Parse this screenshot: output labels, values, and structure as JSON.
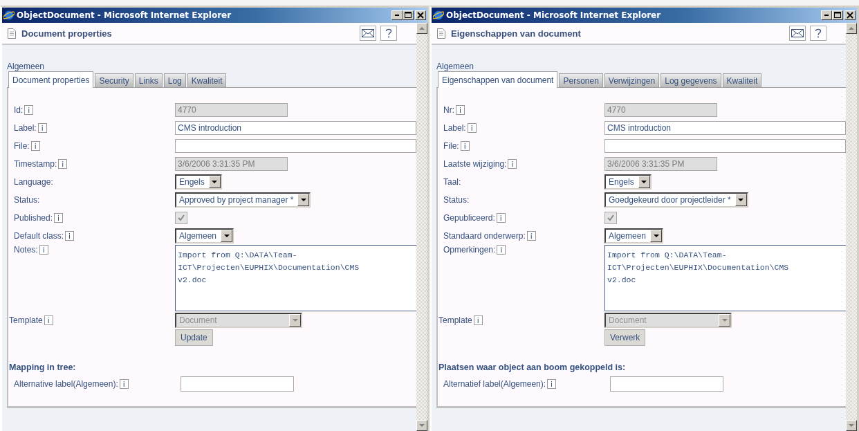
{
  "windows": [
    {
      "title": "ObjectDocument - Microsoft Internet Explorer",
      "page_title": "Document properties",
      "section": "Algemeen",
      "tabs": [
        {
          "label": "Document properties",
          "selected": true
        },
        {
          "label": "Security",
          "selected": false
        },
        {
          "label": "Links",
          "selected": false
        },
        {
          "label": "Log",
          "selected": false
        },
        {
          "label": "Kwaliteit",
          "selected": false
        }
      ],
      "fields": [
        {
          "kind": "text",
          "label": "Id:",
          "info": "i",
          "value": "4770",
          "disabled": true
        },
        {
          "kind": "text",
          "label": "Label:",
          "info": "i",
          "value": "CMS introduction",
          "disabled": false
        },
        {
          "kind": "text",
          "label": "File:",
          "info": "i",
          "disabled": false
        },
        {
          "kind": "text",
          "label": "Timestamp:",
          "info": "i",
          "value": "3/6/2006 3:31:35 PM",
          "disabled": true
        },
        {
          "kind": "select",
          "label": "Language:",
          "value": "Engels",
          "disabled": false
        },
        {
          "kind": "select",
          "label": "Status:",
          "value": "Approved by project manager *",
          "disabled": false
        },
        {
          "kind": "checkbox",
          "label": "Published:",
          "info": "i",
          "checked": true,
          "disabled": true
        },
        {
          "kind": "select",
          "label": "Default class:",
          "info": "i",
          "value": "Algemeen",
          "disabled": false
        },
        {
          "kind": "textarea",
          "label": "Notes:",
          "info": "i",
          "value": "Import from Q:\\DATA\\Team-\nICT\\Projecten\\EUPHIX\\Documentation\\CMS\nv2.doc"
        }
      ],
      "template": {
        "label": "Template",
        "info": "i",
        "value": "Document",
        "disabled": true
      },
      "button": "Update",
      "mapping": {
        "heading": "Mapping in tree:",
        "label": "Alternative label(Algemeen):",
        "info": "i"
      }
    },
    {
      "title": "ObjectDocument - Microsoft Internet Explorer",
      "page_title": "Eigenschappen van document",
      "section": "Algemeen",
      "tabs": [
        {
          "label": "Eigenschappen van document",
          "selected": true
        },
        {
          "label": "Personen",
          "selected": false
        },
        {
          "label": "Verwijzingen",
          "selected": false
        },
        {
          "label": "Log gegevens",
          "selected": false
        },
        {
          "label": "Kwaliteit",
          "selected": false
        }
      ],
      "fields": [
        {
          "kind": "text",
          "label": "Nr:",
          "info": "i",
          "value": "4770",
          "disabled": true
        },
        {
          "kind": "text",
          "label": "Label:",
          "info": "i",
          "value": "CMS introduction",
          "disabled": false
        },
        {
          "kind": "text",
          "label": "File:",
          "info": "i",
          "disabled": false
        },
        {
          "kind": "text",
          "label": "Laatste wijziging:",
          "info": "i",
          "value": "3/6/2006 3:31:35 PM",
          "disabled": true
        },
        {
          "kind": "select",
          "label": "Taal:",
          "value": "Engels",
          "disabled": false
        },
        {
          "kind": "select",
          "label": "Status:",
          "value": "Goedgekeurd door projectleider *",
          "disabled": false
        },
        {
          "kind": "checkbox",
          "label": "Gepubliceerd:",
          "info": "i",
          "checked": true,
          "disabled": true
        },
        {
          "kind": "select",
          "label": "Standaard onderwerp:",
          "info": "i",
          "value": "Algemeen",
          "disabled": false
        },
        {
          "kind": "textarea",
          "label": "Opmerkingen:",
          "info": "i",
          "value": "Import from Q:\\DATA\\Team-\nICT\\Projecten\\EUPHIX\\Documentation\\CMS\nv2.doc"
        }
      ],
      "template": {
        "label": "Template",
        "info": "i",
        "value": "Document",
        "disabled": true
      },
      "button": "Verwerk",
      "mapping": {
        "heading": "Plaatsen waar object aan boom gekoppeld is:",
        "label": "Alternatief label(Algemeen):",
        "info": "i"
      }
    }
  ]
}
